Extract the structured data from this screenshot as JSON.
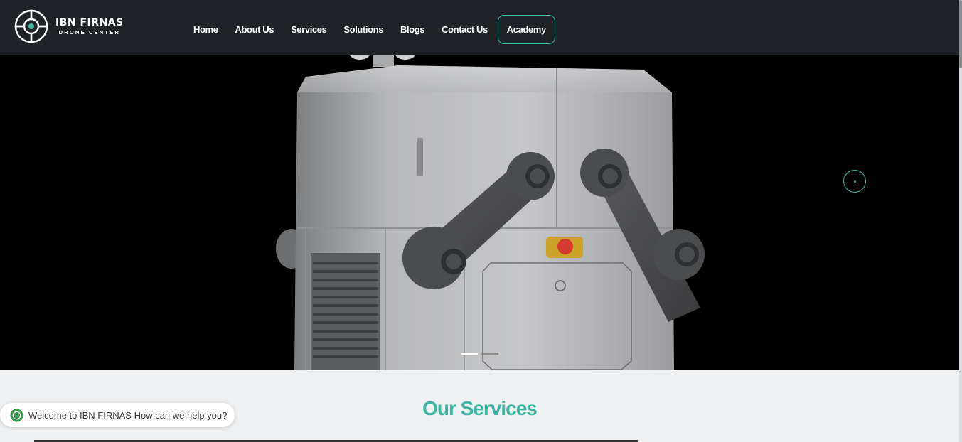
{
  "brand": {
    "name": "IBN FIRNAS",
    "tagline": "DRONE CENTER",
    "accent_color": "#3fb8a6",
    "header_color": "#1f2327"
  },
  "nav": {
    "items": [
      {
        "label": "Home"
      },
      {
        "label": "About Us"
      },
      {
        "label": "Services"
      },
      {
        "label": "Solutions"
      },
      {
        "label": "Blogs"
      },
      {
        "label": "Contact Us"
      }
    ],
    "cta_label": "Academy"
  },
  "hero": {
    "slides_count": 2,
    "active_slide": 1
  },
  "services": {
    "title": "Our Services"
  },
  "whatsapp": {
    "message": "Welcome to IBN FIRNAS How can we help you?",
    "icon": "whatsapp-icon"
  }
}
